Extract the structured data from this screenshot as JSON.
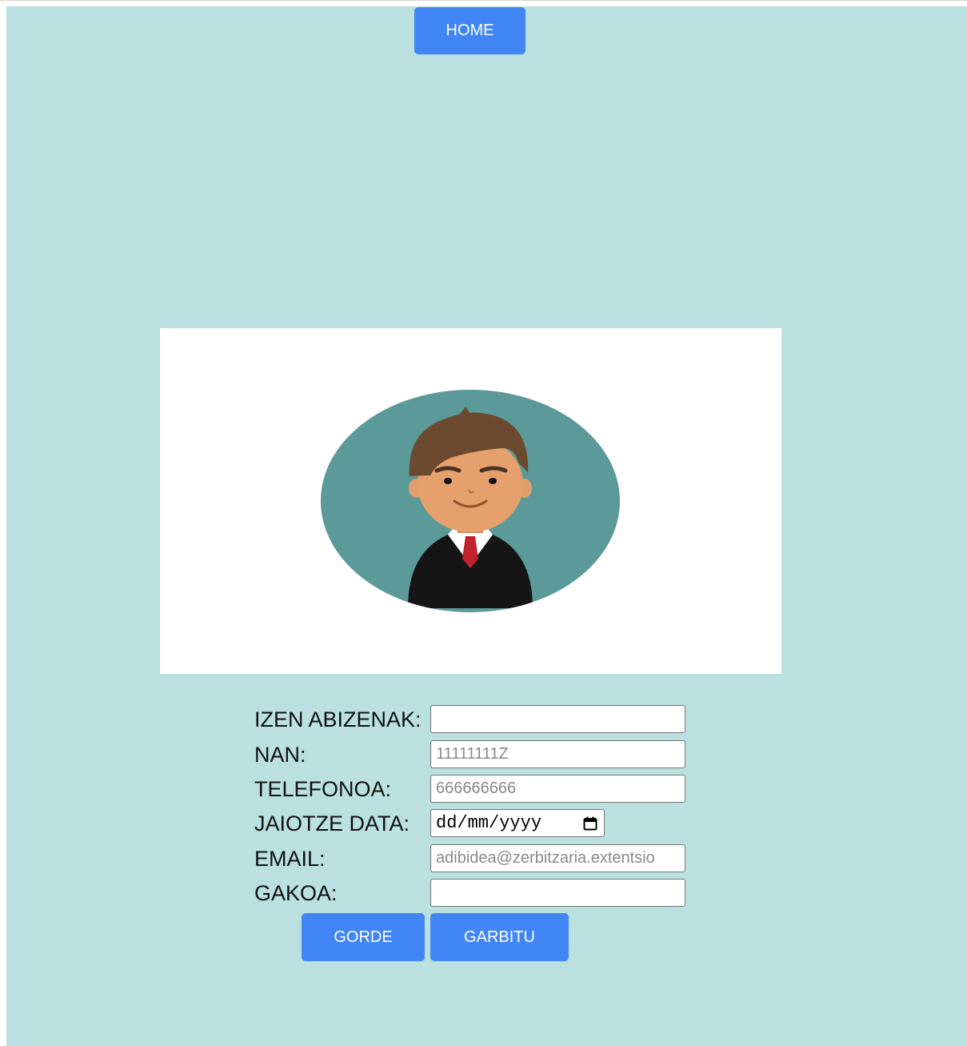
{
  "nav": {
    "home_label": "HOME"
  },
  "avatar": {
    "alt": "user avatar"
  },
  "form": {
    "fields": [
      {
        "label": "IZEN ABIZENAK:",
        "value": "",
        "placeholder": ""
      },
      {
        "label": "NAN:",
        "value": "",
        "placeholder": "11111111Z"
      },
      {
        "label": "TELEFONOA:",
        "value": "",
        "placeholder": "666666666"
      },
      {
        "label": "JAIOTZE DATA:",
        "value": "dd/mm/yyyy"
      },
      {
        "label": "EMAIL:",
        "value": "",
        "placeholder": "adibidea@zerbitzaria.extentsio"
      },
      {
        "label": "GAKOA:",
        "value": "",
        "placeholder": ""
      }
    ],
    "save_label": "GORDE",
    "clear_label": "GARBITU"
  },
  "colors": {
    "background": "#bae0e0",
    "button": "#4285f4",
    "avatar_circle": "#5b9a99"
  }
}
